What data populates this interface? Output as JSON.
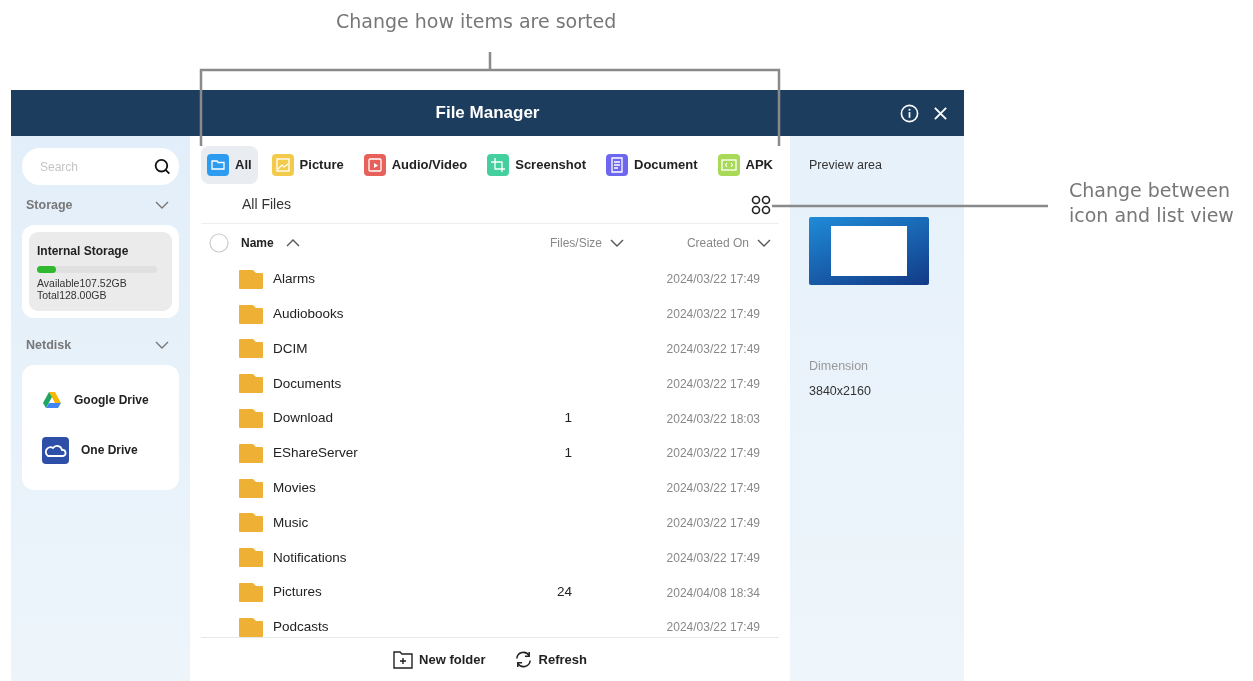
{
  "annotations": [
    {
      "text": "Change how items are sorted"
    },
    {
      "text": "Change between icon and list view"
    }
  ],
  "window": {
    "title": "File Manager"
  },
  "sidebar": {
    "search": {
      "placeholder": "Search"
    },
    "storage_label": "Storage",
    "storage": {
      "name": "Internal Storage",
      "level": 0.16,
      "available": "Available107.52GB",
      "total": "Total128.00GB"
    },
    "netdisk_label": "Netdisk",
    "netdisks": [
      {
        "name": "Google Drive",
        "kind": "google"
      },
      {
        "name": "One Drive",
        "kind": "onedrive"
      }
    ]
  },
  "tabs": [
    {
      "label": "All",
      "selected": true,
      "color": "#2d9cf0",
      "kind": "folder"
    },
    {
      "label": "Picture",
      "selected": false,
      "color": "#f2cb4c",
      "kind": "picture"
    },
    {
      "label": "Audio/Video",
      "selected": false,
      "color": "#e8605a",
      "kind": "video"
    },
    {
      "label": "Screenshot",
      "selected": false,
      "color": "#44cf9e",
      "kind": "crop"
    },
    {
      "label": "Document",
      "selected": false,
      "color": "#6d67f0",
      "kind": "document"
    },
    {
      "label": "APK",
      "selected": false,
      "color": "#a8d957",
      "kind": "code"
    }
  ],
  "breadcrumb": "All Files",
  "table": {
    "select_all_checked": false,
    "columns": [
      "Name",
      "Files/Size",
      "Created On"
    ],
    "rows": [
      {
        "name": "Alarms",
        "count": "",
        "created": "2024/03/22 17:49"
      },
      {
        "name": "Audiobooks",
        "count": "",
        "created": "2024/03/22 17:49"
      },
      {
        "name": "DCIM",
        "count": "",
        "created": "2024/03/22 17:49"
      },
      {
        "name": "Documents",
        "count": "",
        "created": "2024/03/22 17:49"
      },
      {
        "name": "Download",
        "count": "1",
        "created": "2024/03/22 18:03"
      },
      {
        "name": "EShareServer",
        "count": "1",
        "created": "2024/03/22 17:49"
      },
      {
        "name": "Movies",
        "count": "",
        "created": "2024/03/22 17:49"
      },
      {
        "name": "Music",
        "count": "",
        "created": "2024/03/22 17:49"
      },
      {
        "name": "Notifications",
        "count": "",
        "created": "2024/03/22 17:49"
      },
      {
        "name": "Pictures",
        "count": "24",
        "created": "2024/04/08 18:34"
      },
      {
        "name": "Podcasts",
        "count": "",
        "created": "2024/03/22 17:49"
      }
    ]
  },
  "footer_buttons": [
    {
      "label": "New folder",
      "kind": "new-folder"
    },
    {
      "label": "Refresh",
      "kind": "refresh"
    }
  ],
  "preview": {
    "title": "Preview area",
    "dimension_label": "Dimension",
    "dimension": "3840x2160"
  }
}
